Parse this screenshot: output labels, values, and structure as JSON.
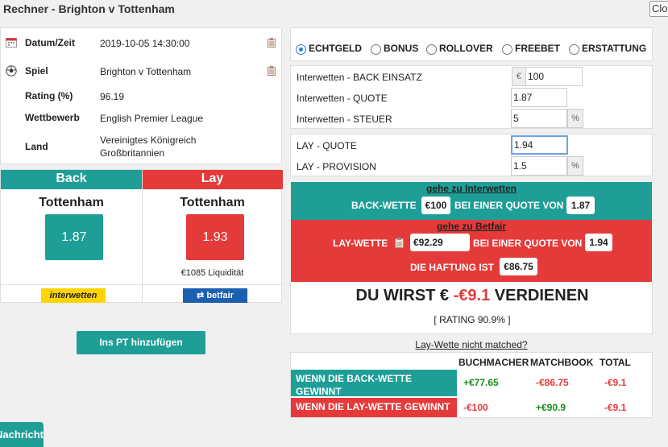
{
  "window": {
    "title": "Rechner - Brighton v Tottenham",
    "close_label": "Close"
  },
  "info": {
    "datetime_label": "Datum/Zeit",
    "datetime_value": "2019-10-05 14:30:00",
    "match_label": "Spiel",
    "match_value": "Brighton v Tottenham",
    "rating_label": "Rating (%)",
    "rating_value": "96.19",
    "competition_label": "Wettbewerb",
    "competition_value": "English Premier League",
    "country_label": "Land",
    "country_value_1": "Vereinigtes Königreich",
    "country_value_2": "Großbritannien"
  },
  "pick": {
    "back_header": "Back",
    "lay_header": "Lay",
    "back_team": "Tottenham",
    "lay_team": "Tottenham",
    "back_odds": "1.87",
    "lay_odds": "1.93",
    "liquidity": "€1085 Liquidität",
    "back_bookmaker_logo": "interwetten",
    "lay_exchange_logo": "betfair"
  },
  "add_pt_button": "Ins PT hinzufügen",
  "bet_types": [
    {
      "label": "ECHTGELD",
      "selected": true
    },
    {
      "label": "BONUS",
      "selected": false
    },
    {
      "label": "ROLLOVER",
      "selected": false
    },
    {
      "label": "FREEBET",
      "selected": false
    },
    {
      "label": "ERSTATTUNG",
      "selected": false
    }
  ],
  "form": {
    "back_stake_label": "Interwetten - BACK EINSATZ",
    "currency_symbol": "€",
    "back_stake_value": "100",
    "back_odds_label": "Interwetten - QUOTE",
    "back_odds_value": "1.87",
    "tax_label": "Interwetten - STEUER",
    "tax_value": "5",
    "percent_symbol": "%",
    "lay_odds_label": "LAY - QUOTE",
    "lay_odds_value": "1.94",
    "commission_label": "LAY - PROVISION",
    "commission_value": "1.5"
  },
  "result": {
    "back_link": "gehe zu Interwetten",
    "back_bet_label": "BACK-WETTE",
    "back_bet_amount": "€100",
    "at_odds_label": "BEI EINER QUOTE VON",
    "back_bet_odds": "1.87",
    "lay_link": "gehe zu Betfair",
    "lay_bet_label": "LAY-WETTE",
    "lay_bet_amount": "€92.29",
    "lay_bet_odds": "1.94",
    "liability_label": "DIE HAFTUNG IST",
    "liability_amount": "€86.75",
    "profit_prefix": "DU WIRST €",
    "profit_value": "-€9.1",
    "profit_suffix": "VERDIENEN",
    "rating": "[ RATING 90.9% ]"
  },
  "not_matched_link": "Lay-Wette nicht matched?",
  "outcome_table": {
    "headers": [
      "BUCHMACHER",
      "MATCHBOOK",
      "TOTAL"
    ],
    "rows": [
      {
        "label_1": "WENN DIE BACK-WETTE",
        "label_2": "GEWINNT",
        "values": [
          "+€77.65",
          "-€86.75",
          "-€9.1"
        ]
      },
      {
        "label_1": "WENN DIE LAY-WETTE GEWINNT",
        "label_2": "",
        "values": [
          "-€100",
          "+€90.9",
          "-€9.1"
        ]
      }
    ]
  },
  "bottom_tab": "Nachricht",
  "colors": {
    "teal": "#1e9e97",
    "red": "#e53a3a",
    "positive": "#1a8a1a"
  }
}
